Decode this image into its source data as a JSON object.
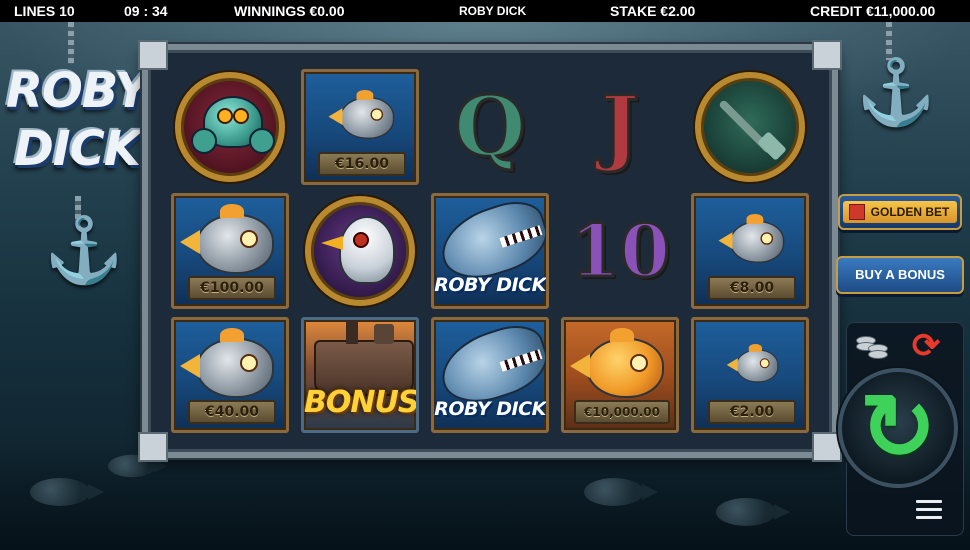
{
  "topbar": {
    "lines": "LINES 10",
    "time": "09 : 34",
    "winnings": "WINNINGS €0.00",
    "game_title": "ROBY DICK",
    "stake": "STAKE €2.00",
    "credit": "CREDIT €11,000.00"
  },
  "logo": {
    "line1": "ROBY",
    "line2": "DICK"
  },
  "reels": [
    [
      {
        "symbol": "crab-medallion"
      },
      {
        "symbol": "silver-fish",
        "value": "€100.00"
      },
      {
        "symbol": "silver-fish",
        "value": "€40.00"
      }
    ],
    [
      {
        "symbol": "silver-fish",
        "value": "€16.00"
      },
      {
        "symbol": "robo-bird-medallion"
      },
      {
        "symbol": "bonus",
        "label": "BONUS"
      }
    ],
    [
      {
        "symbol": "Q",
        "label": "Q"
      },
      {
        "symbol": "wild-whale",
        "label": "ROBY DICK"
      },
      {
        "symbol": "wild-whale",
        "label": "ROBY DICK"
      }
    ],
    [
      {
        "symbol": "J",
        "label": "J"
      },
      {
        "symbol": "10",
        "label": "10"
      },
      {
        "symbol": "gold-fish",
        "value": "€10,000.00"
      }
    ],
    [
      {
        "symbol": "harpoon-medallion"
      },
      {
        "symbol": "silver-fish",
        "value": "€8.00"
      },
      {
        "symbol": "silver-fish",
        "value": "€2.00"
      }
    ]
  ],
  "controls": {
    "golden_bet_label": "GOLDEN BET",
    "buy_bonus_label": "BUY A BONUS",
    "spin_icon": "spin-arrow-icon",
    "autoplay_icon": "autoplay-icon",
    "coins_icon": "coins-icon",
    "menu_icon": "hamburger-menu-icon"
  },
  "colors": {
    "spin_green": "#3fd25a",
    "autoplay_red": "#e8392a",
    "golden": "#f6c54a",
    "frame_silver": "#7c8a94"
  }
}
